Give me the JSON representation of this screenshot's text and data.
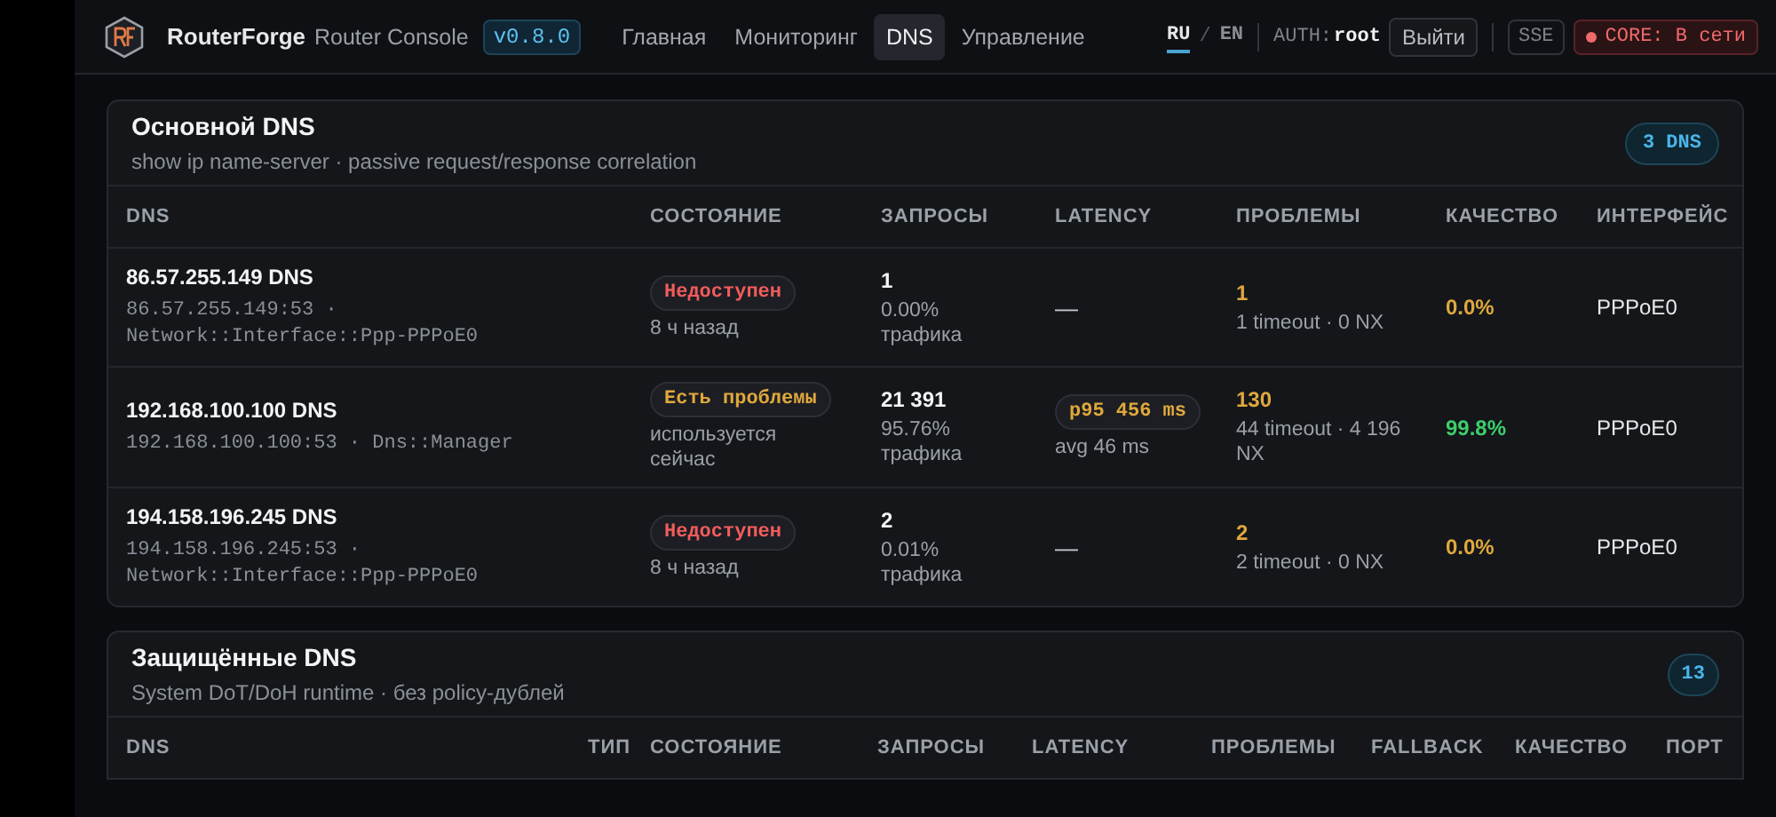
{
  "header": {
    "brand": "RouterForge",
    "subtitle": "Router Console",
    "version": "v0.8.0",
    "nav": [
      {
        "label": "Главная",
        "selected": false
      },
      {
        "label": "Мониторинг",
        "selected": false
      },
      {
        "label": "DNS",
        "selected": true
      },
      {
        "label": "Управление",
        "selected": false
      }
    ],
    "languages": [
      {
        "label": "RU",
        "selected": true
      },
      {
        "label": "EN",
        "selected": false
      }
    ],
    "lang_separator": "/",
    "auth_label": "AUTH:",
    "auth_user": "root",
    "logout": "Выйти",
    "sse": "SSE",
    "core_status": "CORE: В сети"
  },
  "primary": {
    "title": "Основной DNS",
    "subtitle": "show ip name-server · passive request/response correlation",
    "count": "3 DNS",
    "columns": [
      "DNS",
      "СОСТОЯНИЕ",
      "ЗАПРОСЫ",
      "LATENCY",
      "ПРОБЛЕМЫ",
      "КАЧЕСТВО",
      "ИНТЕРФЕЙС"
    ],
    "rows": [
      {
        "name": "86.57.255.149 DNS",
        "detail": "86.57.255.149:53 · Network::Interface::Ppp-PPPoE0",
        "status": {
          "kind": "down",
          "text": "Недоступен"
        },
        "status_note": "8 ч назад",
        "requests": "1",
        "share": "0.00% трафика",
        "latency": {
          "kind": "none",
          "text": "—"
        },
        "problems": "1",
        "problems_note": "1 timeout · 0 NX",
        "quality": {
          "kind": "bad",
          "text": "0.0%"
        },
        "interface": "PPPoE0"
      },
      {
        "name": "192.168.100.100 DNS",
        "detail": "192.168.100.100:53 · Dns::Manager",
        "status": {
          "kind": "warn",
          "text": "Есть проблемы"
        },
        "status_note": "используется сейчас",
        "requests": "21 391",
        "share": "95.76% трафика",
        "latency": {
          "kind": "measured",
          "text": "p95 456 ms",
          "average": "avg 46 ms"
        },
        "problems": "130",
        "problems_note": "44 timeout · 4 196 NX",
        "quality": {
          "kind": "good",
          "text": "99.8%"
        },
        "interface": "PPPoE0"
      },
      {
        "name": "194.158.196.245 DNS",
        "detail": "194.158.196.245:53 · Network::Interface::Ppp-PPPoE0",
        "status": {
          "kind": "down",
          "text": "Недоступен"
        },
        "status_note": "8 ч назад",
        "requests": "2",
        "share": "0.01% трафика",
        "latency": {
          "kind": "none",
          "text": "—"
        },
        "problems": "2",
        "problems_note": "2 timeout · 0 NX",
        "quality": {
          "kind": "bad",
          "text": "0.0%"
        },
        "interface": "PPPoE0"
      }
    ]
  },
  "secure": {
    "title": "Защищённые DNS",
    "subtitle": "System DoT/DoH runtime · без policy-дублей",
    "count": "13",
    "columns": [
      "DNS",
      "ТИП",
      "СОСТОЯНИЕ",
      "ЗАПРОСЫ",
      "LATENCY",
      "ПРОБЛЕМЫ",
      "FALLBACK",
      "КАЧЕСТВО",
      "ПОРТ"
    ]
  }
}
